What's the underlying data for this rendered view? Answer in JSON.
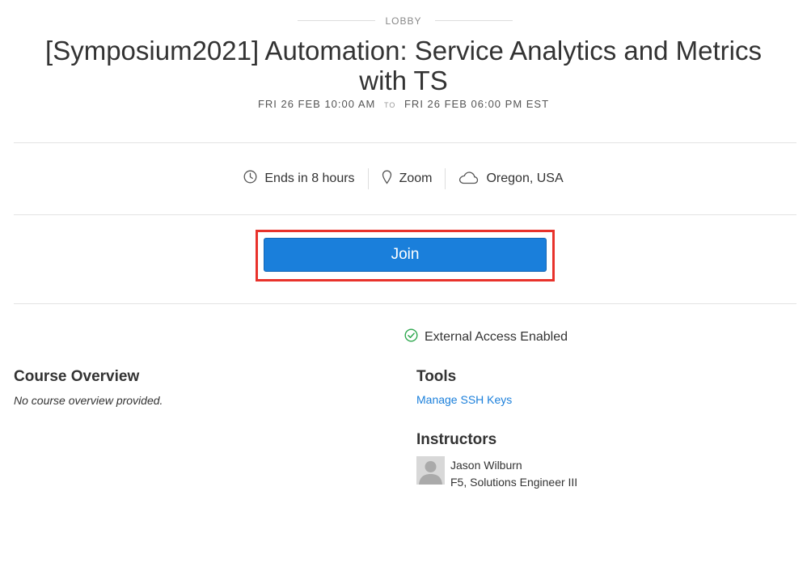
{
  "header": {
    "lobby_label": "LOBBY",
    "title": "[Symposium2021] Automation: Service Analytics and Metrics with TS",
    "date_start": "FRI 26 FEB 10:00 AM",
    "date_to": "TO",
    "date_end": "FRI 26 FEB 06:00 PM EST"
  },
  "meta": {
    "ends_in": "Ends in 8 hours",
    "location": "Zoom",
    "region": "Oregon, USA"
  },
  "join": {
    "label": "Join",
    "button_color": "#1a7fdb",
    "highlight_color": "#e8322b"
  },
  "access": {
    "label": "External Access Enabled",
    "icon": "check-circle-icon",
    "color": "#2fa84f"
  },
  "course": {
    "title": "Course Overview",
    "body": "No course overview provided."
  },
  "tools": {
    "title": "Tools",
    "ssh_link": "Manage SSH Keys"
  },
  "instructors": {
    "title": "Instructors",
    "items": [
      {
        "name": "Jason Wilburn",
        "role": "F5, Solutions Engineer III"
      }
    ]
  }
}
